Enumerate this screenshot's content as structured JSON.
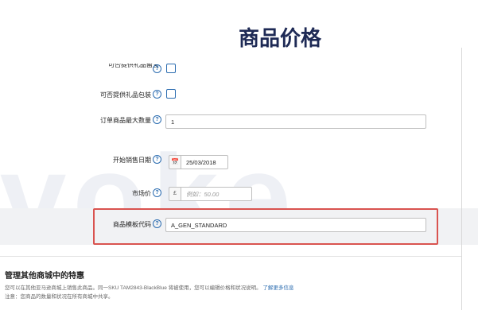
{
  "page_title": "商品价格",
  "watermark": "voke",
  "form": {
    "partial_label": "可否提供礼品留言",
    "gift_wrap_label": "可否提供礼品包装",
    "max_qty_label": "订单商品最大数量",
    "max_qty_value": "1",
    "launch_date_label": "开始销售日期",
    "launch_date_value": "25/03/2018",
    "list_price_label": "市场价",
    "currency_symbol": "£",
    "list_price_placeholder": "例如：50.00",
    "shipping_template_label": "商品模板代码",
    "shipping_template_value": "A_GEN_STANDARD"
  },
  "section": {
    "title": "管理其他商城中的特惠",
    "line1": "您可以在其他亚马逊商城上销售此商品。同一SKU TAM2843-BlackBlue 将被使用，您可以编辑价格和状况说明。",
    "learn_more": "了解更多信息",
    "line2": "注意：您商品的数量和状况在所有商城中共享。"
  },
  "colors": {
    "title": "#1e2a55",
    "highlight": "#d9534f",
    "link": "#2b6cb0"
  }
}
